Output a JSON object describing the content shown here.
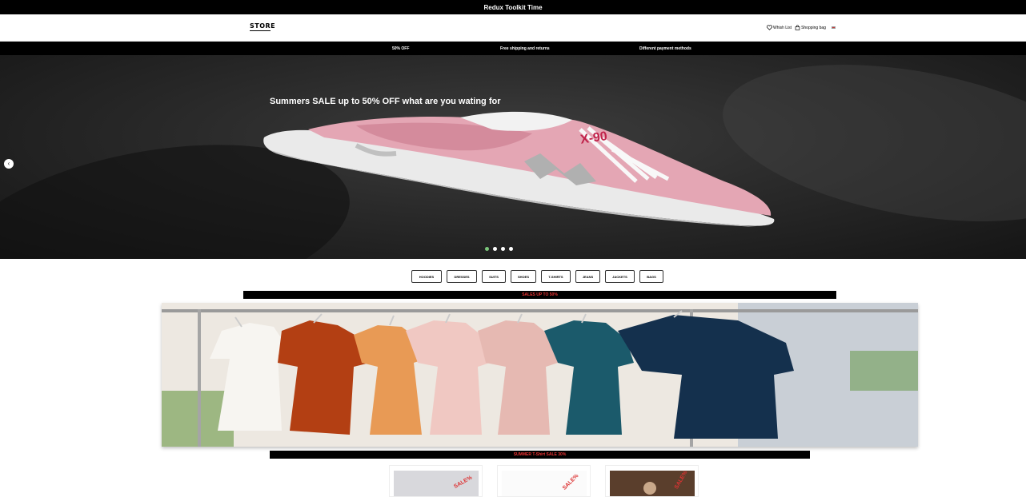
{
  "topbar": {
    "title": "Redux Toolkit Time"
  },
  "header": {
    "logo": "STORE",
    "wishlist": "Whish List",
    "bag": "Shopping bag"
  },
  "promo": {
    "items": [
      "50% OFF",
      "Free shipping and returns",
      "Different payment methods"
    ]
  },
  "hero": {
    "headline": "Summers SALE up to 50% OFF what are you wating for",
    "shoe_model": "X-90",
    "slides": 4,
    "active_slide": 1
  },
  "categories": [
    "HOODIES",
    "DRESSES",
    "SUITS",
    "SHOES",
    "T-SHIRTS",
    "JEANS",
    "JACKETS",
    "BAGS"
  ],
  "sections": {
    "sale1": "SALES UP TO 50%",
    "sale2": "SUMMER T-Shirt SALE 30%"
  },
  "products": {
    "sale_tag": "SALE%"
  },
  "colors": {
    "accent": "#e33333",
    "dot_active": "#7ac67a"
  }
}
